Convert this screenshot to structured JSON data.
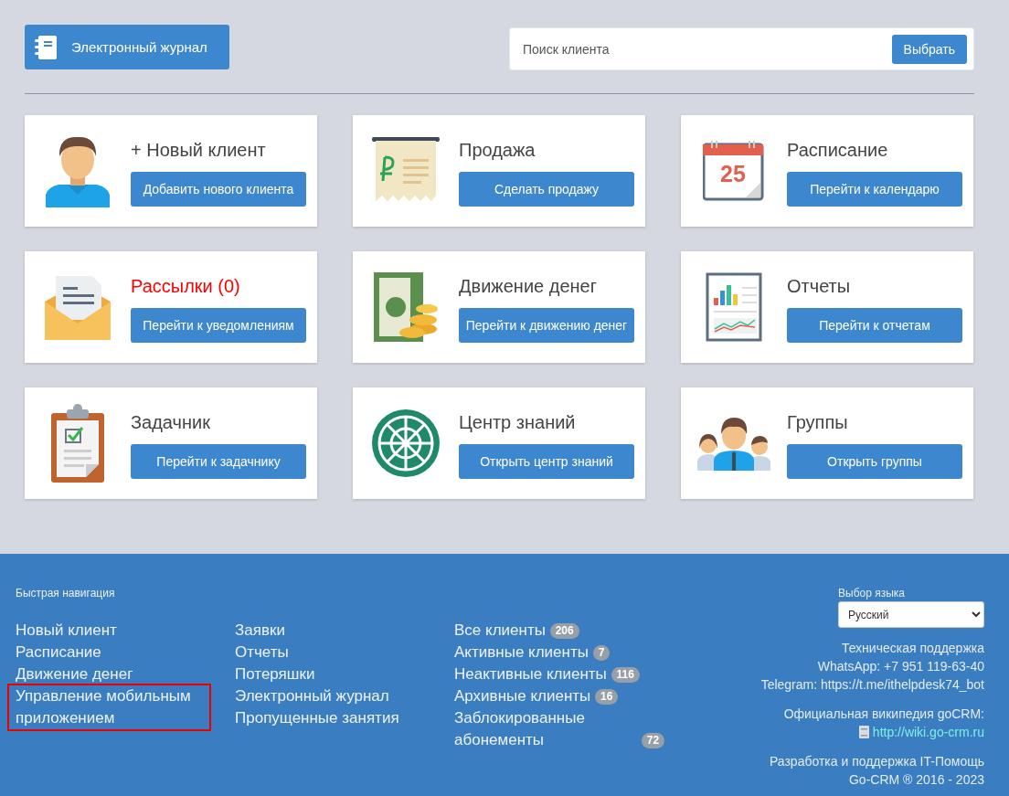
{
  "journal_button": {
    "label": "Электронный журнал"
  },
  "search": {
    "placeholder": "Поиск клиента",
    "button": "Выбрать"
  },
  "cards": [
    {
      "kind": "person",
      "title": "+ Новый клиент",
      "alert": false,
      "button": "Добавить нового клиента"
    },
    {
      "kind": "receipt",
      "title": "Продажа",
      "alert": false,
      "button": "Сделать продажу"
    },
    {
      "kind": "calendar",
      "icon_text": "25",
      "title": "Расписание",
      "alert": false,
      "button": "Перейти к календарю"
    },
    {
      "kind": "envelope",
      "title": "Рассылки (0)",
      "alert": true,
      "button": "Перейти к уведомлениям"
    },
    {
      "kind": "money",
      "title": "Движение денег",
      "alert": false,
      "button": "Перейти к движению денег"
    },
    {
      "kind": "report",
      "title": "Отчеты",
      "alert": false,
      "button": "Перейти к отчетам"
    },
    {
      "kind": "clipboard",
      "title": "Задачник",
      "alert": false,
      "button": "Перейти к задачнику"
    },
    {
      "kind": "wheel",
      "title": "Центр знаний",
      "alert": false,
      "button": "Открыть центр знаний"
    },
    {
      "kind": "group",
      "title": "Группы",
      "alert": false,
      "button": "Открыть группы"
    }
  ],
  "footer": {
    "heading": "Быстрая навигация",
    "columns": [
      [
        {
          "label": "Новый клиент",
          "highlighted": false
        },
        {
          "label": "Расписание",
          "highlighted": false
        },
        {
          "label": "Движение денег",
          "highlighted": false
        },
        {
          "label": "Управление мобильным приложением",
          "highlighted": true
        }
      ],
      [
        {
          "label": "Заявки",
          "highlighted": false
        },
        {
          "label": "Отчеты",
          "highlighted": false
        },
        {
          "label": "Потеряшки",
          "highlighted": false
        },
        {
          "label": "Электронный журнал",
          "highlighted": false
        },
        {
          "label": "Пропущенные занятия",
          "highlighted": false
        }
      ],
      [
        {
          "label": "Все клиенты",
          "count": "206",
          "highlighted": false
        },
        {
          "label": "Активные клиенты",
          "count": "7",
          "highlighted": false
        },
        {
          "label": "Неактивные клиенты",
          "count": "116",
          "highlighted": false
        },
        {
          "label": "Архивные клиенты",
          "count": "16",
          "highlighted": false
        },
        {
          "label": "Заблокированные абонементы",
          "count": "72",
          "highlighted": false
        }
      ]
    ],
    "language": {
      "label": "Выбор языка",
      "value": "Русский"
    },
    "support": [
      "Техническая поддержка",
      "WhatsApp: +7 951 119-63-40",
      "Telegram: https://t.me/ithelpdesk74_bot"
    ],
    "wiki": {
      "label": "Официальная википедия goCRM:",
      "link": "http://wiki.go-crm.ru"
    },
    "credits": [
      "Разработка и поддержка IT-Помощь",
      "Go-CRM ® 2016 - 2023"
    ]
  }
}
